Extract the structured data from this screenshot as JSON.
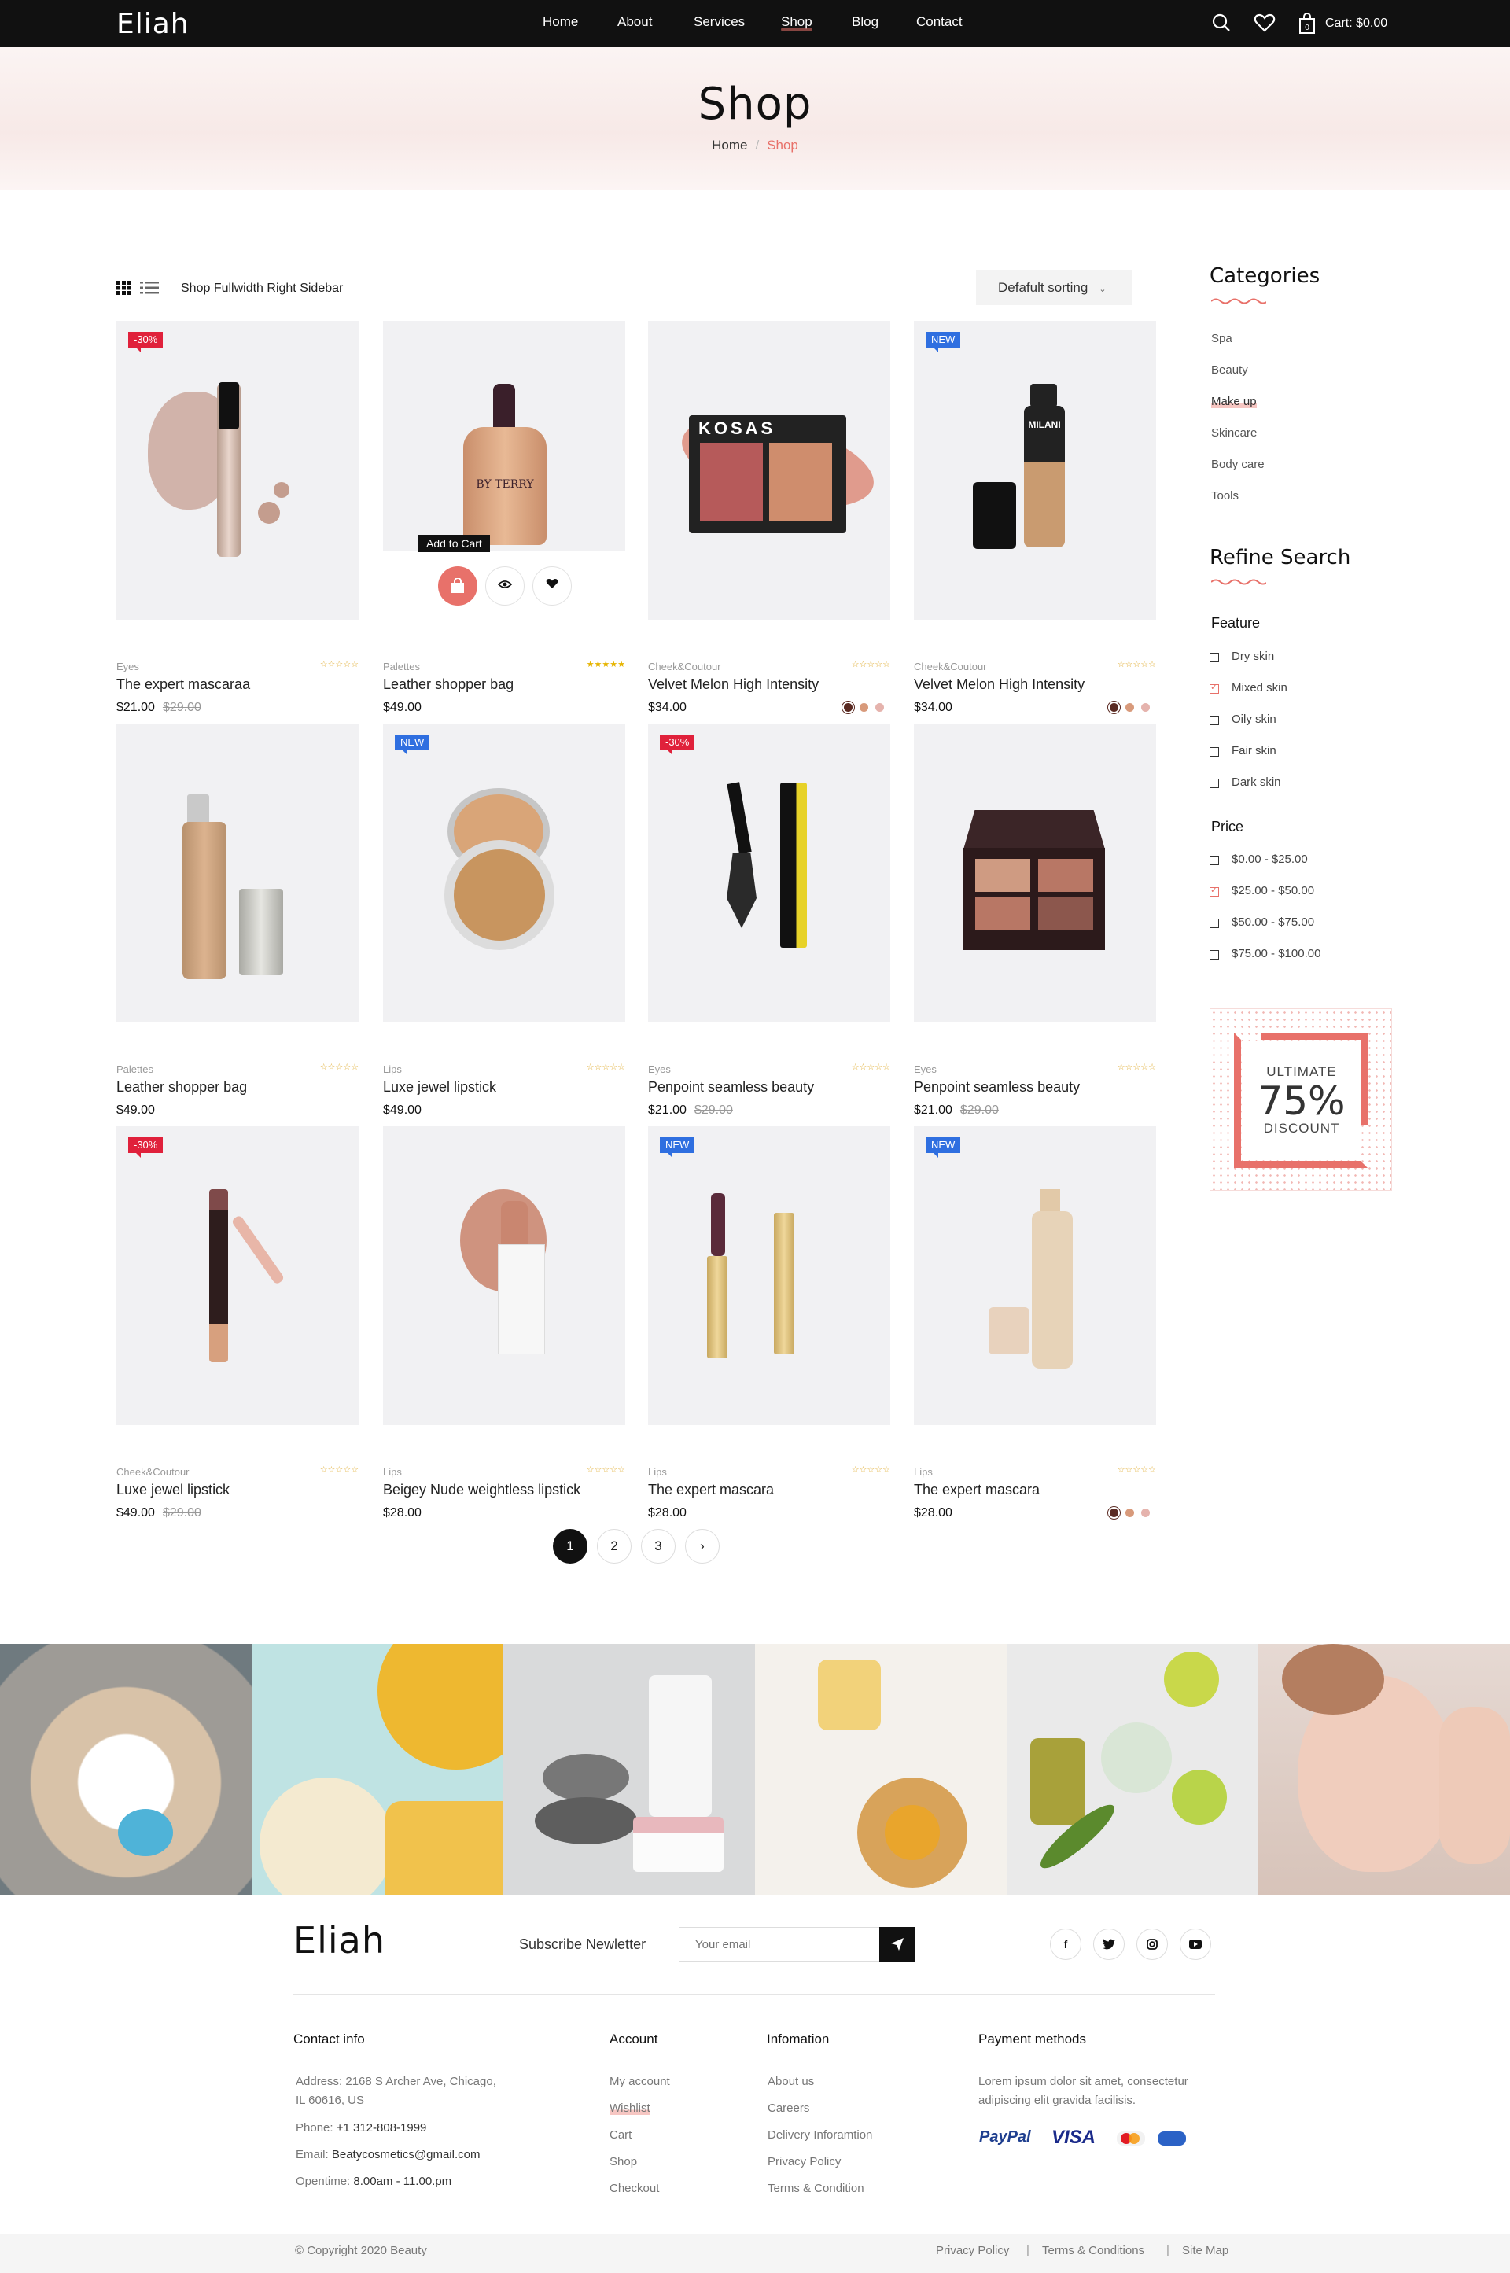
{
  "header": {
    "logo": "Eliah",
    "nav": [
      "Home",
      "About",
      "Services",
      "Shop",
      "Blog",
      "Contact"
    ],
    "active_nav": "Shop",
    "cart_label": "Cart: $0.00"
  },
  "hero": {
    "title": "Shop",
    "breadcrumb_home": "Home",
    "breadcrumb_sep": "/",
    "breadcrumb_current": "Shop"
  },
  "toolbar": {
    "view_label": "Shop Fullwidth Right Sidebar",
    "sort_label": "Defafult sorting"
  },
  "hover_tooltip": "Add to Cart",
  "products": [
    {
      "category": "Eyes",
      "name": "The expert mascaraa",
      "price": "$21.00",
      "old_price": "$29.00",
      "badge": "-30%",
      "badge_type": "sale",
      "rating_full": false,
      "swatches": []
    },
    {
      "category": "Palettes",
      "name": "Leather shopper bag",
      "price": "$49.00",
      "old_price": "",
      "badge": "",
      "badge_type": "",
      "rating_full": true,
      "swatches": []
    },
    {
      "category": "Cheek&Coutour",
      "name": "Velvet Melon High Intensity",
      "price": "$34.00",
      "old_price": "",
      "badge": "",
      "badge_type": "",
      "rating_full": false,
      "swatches": [
        "#5a2a22",
        "#d89a7b",
        "#e5b3ad"
      ]
    },
    {
      "category": "Cheek&Coutour",
      "name": "Velvet Melon High Intensity",
      "price": "$34.00",
      "old_price": "",
      "badge": "NEW",
      "badge_type": "new",
      "rating_full": false,
      "swatches": [
        "#5a2a22",
        "#d89a7b",
        "#e5b3ad"
      ]
    },
    {
      "category": "Palettes",
      "name": "Leather shopper bag",
      "price": "$49.00",
      "old_price": "",
      "badge": "",
      "badge_type": "",
      "rating_full": false,
      "swatches": []
    },
    {
      "category": "Lips",
      "name": "Luxe jewel lipstick",
      "price": "$49.00",
      "old_price": "",
      "badge": "NEW",
      "badge_type": "new",
      "rating_full": false,
      "swatches": []
    },
    {
      "category": "Eyes",
      "name": "Penpoint seamless beauty",
      "price": "$21.00",
      "old_price": "$29.00",
      "badge": "-30%",
      "badge_type": "sale",
      "rating_full": false,
      "swatches": []
    },
    {
      "category": "Eyes",
      "name": "Penpoint seamless beauty",
      "price": "$21.00",
      "old_price": "$29.00",
      "badge": "",
      "badge_type": "",
      "rating_full": false,
      "swatches": []
    },
    {
      "category": "Cheek&Coutour",
      "name": "Luxe jewel lipstick",
      "price": "$49.00",
      "old_price": "$29.00",
      "badge": "-30%",
      "badge_type": "sale",
      "rating_full": false,
      "swatches": []
    },
    {
      "category": "Lips",
      "name": "Beigey Nude weightless lipstick",
      "price": "$28.00",
      "old_price": "",
      "badge": "",
      "badge_type": "",
      "rating_full": false,
      "swatches": []
    },
    {
      "category": "Lips",
      "name": "The expert mascara",
      "price": "$28.00",
      "old_price": "",
      "badge": "NEW",
      "badge_type": "new",
      "rating_full": false,
      "swatches": []
    },
    {
      "category": "Lips",
      "name": "The expert mascara",
      "price": "$28.00",
      "old_price": "",
      "badge": "NEW",
      "badge_type": "new",
      "rating_full": false,
      "swatches": [
        "#5a2a22",
        "#d89a7b",
        "#e5b3ad"
      ]
    }
  ],
  "sidebar": {
    "categories_title": "Categories",
    "categories": [
      "Spa",
      "Beauty",
      "Make up",
      "Skincare",
      "Body care",
      "Tools"
    ],
    "active_category": "Make up",
    "refine_title": "Refine Search",
    "feature_title": "Feature",
    "features": [
      {
        "label": "Dry skin",
        "checked": false
      },
      {
        "label": "Mixed skin",
        "checked": true
      },
      {
        "label": "Oily skin",
        "checked": false
      },
      {
        "label": "Fair skin",
        "checked": false
      },
      {
        "label": "Dark skin",
        "checked": false
      }
    ],
    "price_title": "Price",
    "prices": [
      {
        "label": "$0.00 - $25.00",
        "checked": false
      },
      {
        "label": "$25.00 - $50.00",
        "checked": true
      },
      {
        "label": "$50.00 - $75.00",
        "checked": false
      },
      {
        "label": "$75.00 - $100.00",
        "checked": false
      }
    ],
    "promo": {
      "line1": "ULTIMATE",
      "line2": "75%",
      "line3": "DISCOUNT"
    }
  },
  "pagination": {
    "pages": [
      "1",
      "2",
      "3"
    ],
    "current": "1",
    "next": "›"
  },
  "footer": {
    "logo": "Eliah",
    "subscribe_label": "Subscribe Newletter",
    "email_placeholder": "Your email",
    "social": [
      "f",
      "t",
      "ig",
      "yt"
    ],
    "contact_title": "Contact info",
    "address": "Address: 2168 S Archer Ave, Chicago,",
    "address2": "IL 60616, US",
    "phone_label": "Phone:",
    "phone": "+1 312-808-1999",
    "email_label": "Email:",
    "email": "Beatycosmetics@gmail.com",
    "opentime_label": "Opentime:",
    "opentime": "8.00am - 11.00.pm",
    "account_title": "Account",
    "account_links": [
      "My account",
      "Wishlist",
      "Cart",
      "Shop",
      "Checkout"
    ],
    "info_title": "Infomation",
    "info_links": [
      "About us",
      "Careers",
      "Delivery Inforamtion",
      "Privacy Policy",
      "Terms & Condition"
    ],
    "payment_title": "Payment methods",
    "payment_text1": "Lorem ipsum dolor sit amet, consectetur",
    "payment_text2": "adipiscing elit gravida facilisis.",
    "payment_brands": [
      "PayPal",
      "VISA",
      "MC",
      "Cirrus"
    ],
    "copyright": "© Copyright 2020 Beauty",
    "bottom_links": [
      "Privacy Policy",
      "Terms & Conditions",
      "Site Map"
    ]
  },
  "colors": {
    "accent": "#e8716a",
    "sale": "#e0213b",
    "new": "#2f6fe0",
    "dark": "#111111"
  }
}
